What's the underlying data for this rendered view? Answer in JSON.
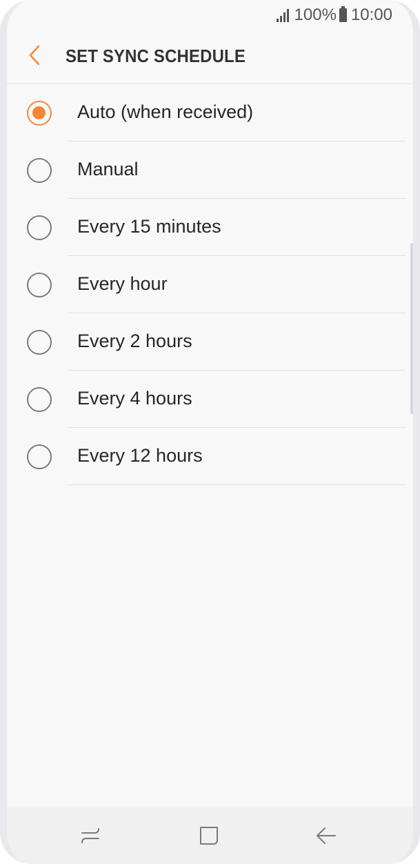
{
  "status_bar": {
    "battery_percent": "100%",
    "time": "10:00"
  },
  "header": {
    "title": "SET SYNC SCHEDULE",
    "back_icon": "chevron-left-icon"
  },
  "options": [
    {
      "label": "Auto (when received)",
      "selected": true
    },
    {
      "label": "Manual",
      "selected": false
    },
    {
      "label": "Every 15 minutes",
      "selected": false
    },
    {
      "label": "Every hour",
      "selected": false
    },
    {
      "label": "Every 2 hours",
      "selected": false
    },
    {
      "label": "Every 4 hours",
      "selected": false
    },
    {
      "label": "Every 12 hours",
      "selected": false
    }
  ],
  "nav_bar": {
    "icons": [
      "recent-apps-icon",
      "home-icon",
      "back-arrow-icon"
    ]
  },
  "colors": {
    "accent": "#f48737",
    "background": "#f8f8f8",
    "text": "#262626"
  }
}
